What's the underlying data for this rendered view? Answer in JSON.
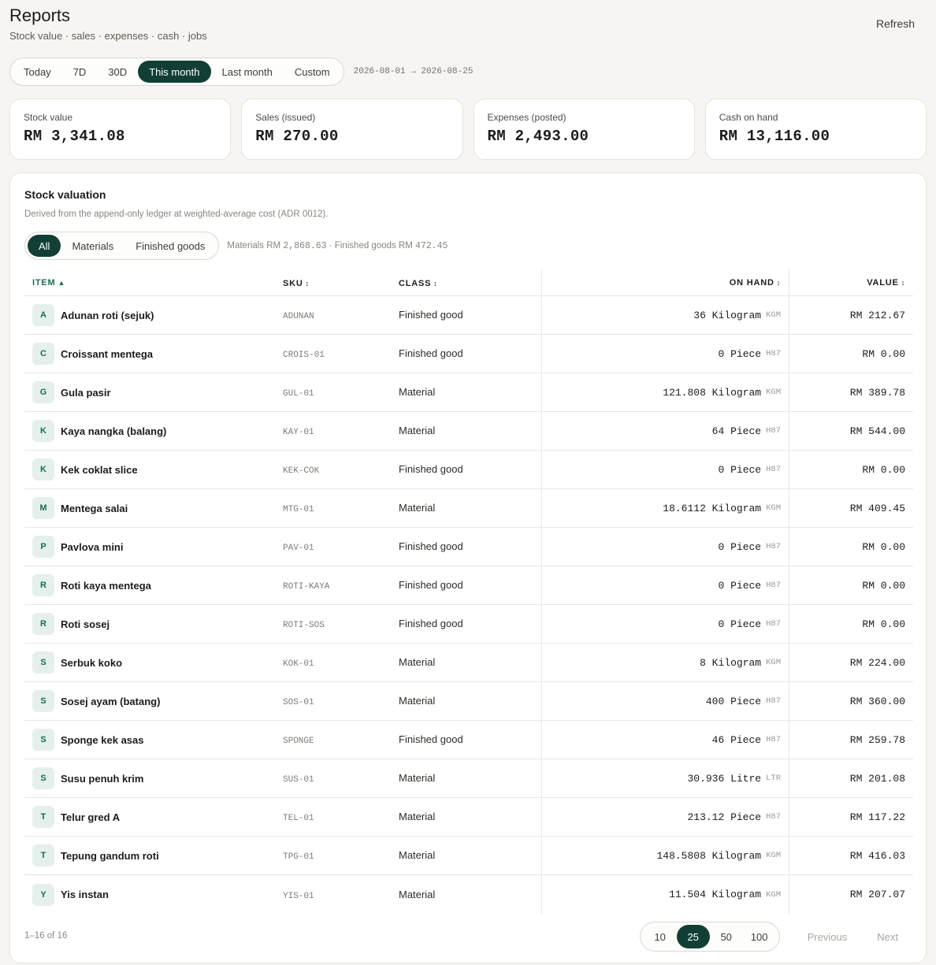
{
  "header": {
    "title": "Reports",
    "subtitle": "Stock value · sales · expenses · cash · jobs",
    "refresh_label": "Refresh"
  },
  "range": {
    "options": [
      "Today",
      "7D",
      "30D",
      "This month",
      "Last month",
      "Custom"
    ],
    "active": "This month",
    "text": "2026-08-01 → 2026-08-25"
  },
  "stats": [
    {
      "label": "Stock value",
      "value": "RM 3,341.08"
    },
    {
      "label": "Sales (issued)",
      "value": "RM 270.00"
    },
    {
      "label": "Expenses (posted)",
      "value": "RM 2,493.00"
    },
    {
      "label": "Cash on hand",
      "value": "RM 13,116.00"
    }
  ],
  "panel": {
    "title": "Stock valuation",
    "description": "Derived from the append-only ledger at weighted-average cost (ADR 0012).",
    "filters": [
      "All",
      "Materials",
      "Finished goods"
    ],
    "active_filter": "All",
    "summary": {
      "materials_label": "Materials RM",
      "materials_value": "2,868.63",
      "sep": " · ",
      "finished_label": "Finished goods RM",
      "finished_value": "472.45"
    }
  },
  "table": {
    "headers": {
      "item": "ITEM",
      "sku": "SKU",
      "class": "CLASS",
      "onhand": "ON HAND",
      "value": "VALUE"
    },
    "sort_glyphs": {
      "asc": "▲",
      "both": "↕"
    },
    "rows": [
      {
        "initial": "A",
        "name": "Adunan roti (sejuk)",
        "sku": "ADUNAN",
        "class": "Finished good",
        "qty": "36 Kilogram",
        "unit": "KGM",
        "value": "RM 212.67"
      },
      {
        "initial": "C",
        "name": "Croissant mentega",
        "sku": "CROIS-01",
        "class": "Finished good",
        "qty": "0 Piece",
        "unit": "H87",
        "value": "RM 0.00"
      },
      {
        "initial": "G",
        "name": "Gula pasir",
        "sku": "GUL-01",
        "class": "Material",
        "qty": "121.808 Kilogram",
        "unit": "KGM",
        "value": "RM 389.78"
      },
      {
        "initial": "K",
        "name": "Kaya nangka (balang)",
        "sku": "KAY-01",
        "class": "Material",
        "qty": "64 Piece",
        "unit": "H87",
        "value": "RM 544.00"
      },
      {
        "initial": "K",
        "name": "Kek coklat slice",
        "sku": "KEK-COK",
        "class": "Finished good",
        "qty": "0 Piece",
        "unit": "H87",
        "value": "RM 0.00"
      },
      {
        "initial": "M",
        "name": "Mentega salai",
        "sku": "MTG-01",
        "class": "Material",
        "qty": "18.6112 Kilogram",
        "unit": "KGM",
        "value": "RM 409.45"
      },
      {
        "initial": "P",
        "name": "Pavlova mini",
        "sku": "PAV-01",
        "class": "Finished good",
        "qty": "0 Piece",
        "unit": "H87",
        "value": "RM 0.00"
      },
      {
        "initial": "R",
        "name": "Roti kaya mentega",
        "sku": "ROTI-KAYA",
        "class": "Finished good",
        "qty": "0 Piece",
        "unit": "H87",
        "value": "RM 0.00"
      },
      {
        "initial": "R",
        "name": "Roti sosej",
        "sku": "ROTI-SOS",
        "class": "Finished good",
        "qty": "0 Piece",
        "unit": "H87",
        "value": "RM 0.00"
      },
      {
        "initial": "S",
        "name": "Serbuk koko",
        "sku": "KOK-01",
        "class": "Material",
        "qty": "8 Kilogram",
        "unit": "KGM",
        "value": "RM 224.00"
      },
      {
        "initial": "S",
        "name": "Sosej ayam (batang)",
        "sku": "SOS-01",
        "class": "Material",
        "qty": "400 Piece",
        "unit": "H87",
        "value": "RM 360.00"
      },
      {
        "initial": "S",
        "name": "Sponge kek asas",
        "sku": "SPONGE",
        "class": "Finished good",
        "qty": "46 Piece",
        "unit": "H87",
        "value": "RM 259.78"
      },
      {
        "initial": "S",
        "name": "Susu penuh krim",
        "sku": "SUS-01",
        "class": "Material",
        "qty": "30.936 Litre",
        "unit": "LTR",
        "value": "RM 201.08"
      },
      {
        "initial": "T",
        "name": "Telur gred A",
        "sku": "TEL-01",
        "class": "Material",
        "qty": "213.12 Piece",
        "unit": "H87",
        "value": "RM 117.22"
      },
      {
        "initial": "T",
        "name": "Tepung gandum roti",
        "sku": "TPG-01",
        "class": "Material",
        "qty": "148.5808 Kilogram",
        "unit": "KGM",
        "value": "RM 416.03"
      },
      {
        "initial": "Y",
        "name": "Yis instan",
        "sku": "YIS-01",
        "class": "Material",
        "qty": "11.504 Kilogram",
        "unit": "KGM",
        "value": "RM 207.07"
      }
    ]
  },
  "footer": {
    "page_info": "1–16 of 16",
    "page_sizes": [
      "10",
      "25",
      "50",
      "100"
    ],
    "active_page_size": "25",
    "previous_label": "Previous",
    "next_label": "Next"
  },
  "colors": {
    "accent": "#123f35",
    "sort_active": "#1d6b57",
    "avatar_bg": "#e5f0ec",
    "background": "#f6f5f1"
  }
}
